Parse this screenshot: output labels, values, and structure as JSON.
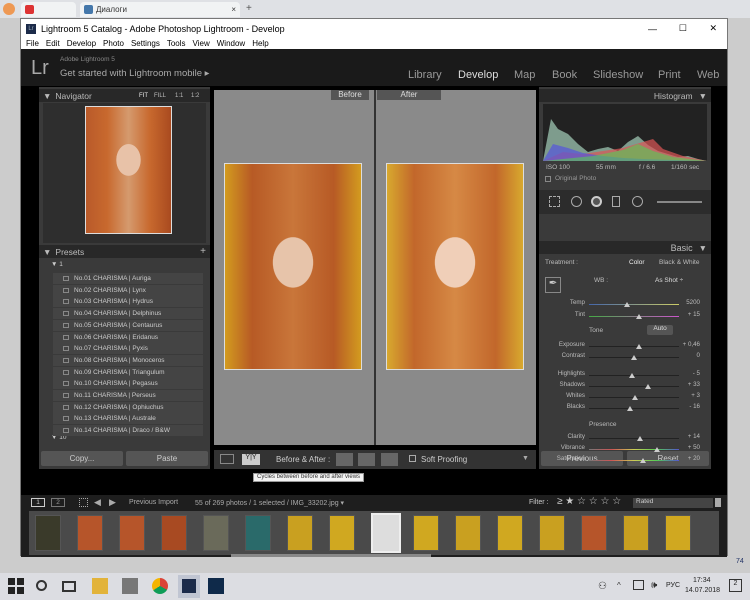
{
  "browser": {
    "tab1": "",
    "tab2": "Диалоги",
    "plus": "+"
  },
  "window": {
    "title": "Lightroom 5 Catalog - Adobe Photoshop Lightroom - Develop",
    "min": "—",
    "max": "☐",
    "close": "✕"
  },
  "menu": [
    "File",
    "Edit",
    "Develop",
    "Photo",
    "Settings",
    "Tools",
    "View",
    "Window",
    "Help"
  ],
  "identity": {
    "logo": "Lr",
    "brand": "Adobe Lightroom 5",
    "mobile": "Get started with Lightroom mobile ▸"
  },
  "modules": [
    "Library",
    "Develop",
    "Map",
    "Book",
    "Slideshow",
    "Print",
    "Web"
  ],
  "navigator": {
    "title": "Navigator",
    "fit": "FIT",
    "fill": "FILL",
    "r1": "1:1",
    "r2": "1:2"
  },
  "presets": {
    "title": "Presets",
    "add": "+",
    "folder1": "1",
    "folder2": "10",
    "items": [
      "No.01 CHARISMA | Auriga",
      "No.02 CHARISMA | Lynx",
      "No.03 CHARISMA | Hydrus",
      "No.04 CHARISMA | Delphinus",
      "No.05 CHARISMA | Centaurus",
      "No.06 CHARISMA | Eridanus",
      "No.07 CHARISMA | Pyxis",
      "No.08 CHARISMA | Monoceros",
      "No.09 CHARISMA | Triangulum",
      "No.10 CHARISMA | Pegasus",
      "No.11 CHARISMA | Perseus",
      "No.12 CHARISMA | Ophiuchus",
      "No.13 CHARISMA | Australe",
      "No.14 CHARISMA | Draco / B&W"
    ]
  },
  "left_buttons": {
    "copy": "Copy...",
    "paste": "Paste"
  },
  "center": {
    "before": "Before",
    "after": "After"
  },
  "toolbar": {
    "yy": "Y|Y",
    "ba_label": "Before & After :",
    "soft": "Soft Proofing",
    "tooltip": "Cycles between before and after views"
  },
  "histogram": {
    "title": "Histogram",
    "iso": "ISO 100",
    "focal": "55 mm",
    "fstop": "f / 6.6",
    "shutter": "1/160 sec",
    "original": "Original Photo"
  },
  "basic": {
    "title": "Basic",
    "treatment": "Treatment :",
    "color": "Color",
    "bw": "Black & White",
    "wb": "WB :",
    "wb_val": "As Shot ÷",
    "tone": "Tone",
    "auto": "Auto",
    "presence": "Presence"
  },
  "sliders": [
    {
      "label": "Temp",
      "value": "5200",
      "pos": 0.42
    },
    {
      "label": "Tint",
      "value": "+ 15",
      "pos": 0.55
    },
    {
      "label": "Exposure",
      "value": "+ 0,46",
      "pos": 0.55
    },
    {
      "label": "Contrast",
      "value": "0",
      "pos": 0.5
    },
    {
      "label": "Highlights",
      "value": "- 5",
      "pos": 0.48
    },
    {
      "label": "Shadows",
      "value": "+ 33",
      "pos": 0.66
    },
    {
      "label": "Whites",
      "value": "+ 3",
      "pos": 0.51
    },
    {
      "label": "Blacks",
      "value": "- 16",
      "pos": 0.45
    },
    {
      "label": "Clarity",
      "value": "+ 14",
      "pos": 0.57
    },
    {
      "label": "Vibrance",
      "value": "+ 50",
      "pos": 0.75
    },
    {
      "label": "Saturation",
      "value": "+ 20",
      "pos": 0.6
    }
  ],
  "right_buttons": {
    "previous": "Previous",
    "reset": "Reset"
  },
  "filmstrip": {
    "p1": "1",
    "p2": "2",
    "source": "Previous Import",
    "count": "55 of 269 photos / 1 selected / IMG_33202.jpg ▾",
    "filter": "Filter :",
    "rated": "Rated"
  },
  "taskbar": {
    "lang": "РУС",
    "time": "17:34",
    "date": "14.07.2018",
    "notif": "2"
  },
  "desktop": {
    "badge": "74"
  }
}
